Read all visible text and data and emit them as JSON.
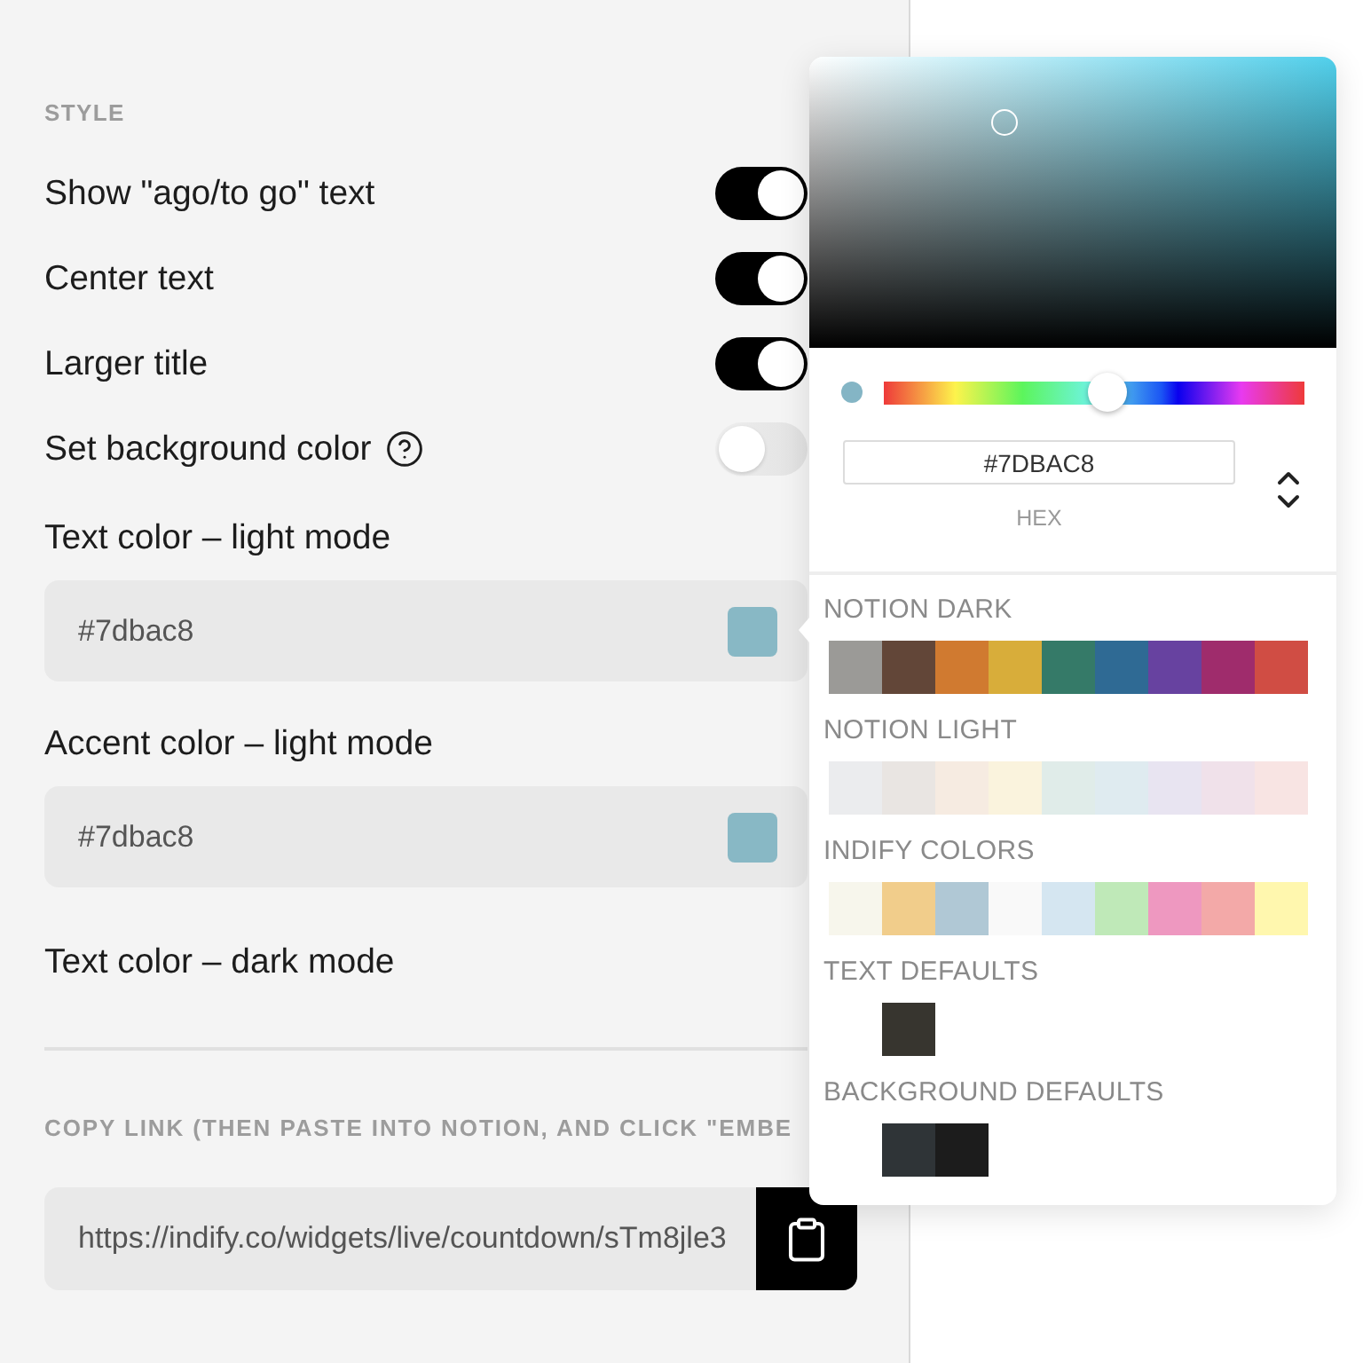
{
  "settings": {
    "heading": "STYLE",
    "toggles": [
      {
        "label": "Show \"ago/to go\" text",
        "on": true
      },
      {
        "label": "Center text",
        "on": true
      },
      {
        "label": "Larger title",
        "on": true
      },
      {
        "label": "Set background color",
        "on": false,
        "help": true
      }
    ]
  },
  "color_fields": [
    {
      "label": "Text color – light mode",
      "value": "#7dbac8",
      "color": "#88b8c5"
    },
    {
      "label": "Accent color – light mode",
      "value": "#7dbac8",
      "color": "#88b8c5"
    },
    {
      "label": "Text color – dark mode"
    }
  ],
  "copy_link": {
    "heading": "COPY LINK (THEN PASTE INTO NOTION, AND CLICK \"EMBE",
    "url": "https://indify.co/widgets/live/countdown/sTm8jle3"
  },
  "color_picker": {
    "saturation": {
      "level": 0.37
    },
    "color": "#84b5c5",
    "hue": {
      "level": 0.53
    },
    "hex": "#7DBAC8",
    "format": "HEX",
    "palettes": [
      {
        "title": "NOTION DARK",
        "kind": "palette",
        "swatches": [
          {
            "color": "#9b9a97"
          },
          {
            "color": "#624638"
          },
          {
            "color": "#d07a30"
          },
          {
            "color": "#d8ad3a"
          },
          {
            "color": "#357a68"
          },
          {
            "color": "#2f6a94"
          },
          {
            "color": "#6742a0"
          },
          {
            "color": "#9f2c6c"
          },
          {
            "color": "#d04d44"
          }
        ]
      },
      {
        "title": "NOTION LIGHT",
        "kind": "palette",
        "swatches": [
          {
            "color": "#ebecee"
          },
          {
            "color": "#e9e5e2"
          },
          {
            "color": "#f6ebe1"
          },
          {
            "color": "#faf3dd"
          },
          {
            "color": "#e0ece9"
          },
          {
            "color": "#dfebf0"
          },
          {
            "color": "#e8e4f1"
          },
          {
            "color": "#f0e1ea"
          },
          {
            "color": "#f8e4e3"
          }
        ]
      },
      {
        "title": "INDIFY COLORS",
        "kind": "palette",
        "swatches": [
          {
            "color": "#f7f6ec"
          },
          {
            "color": "#f1cd8b"
          },
          {
            "color": "#b0c8d5"
          },
          {
            "color": "#f9f9f9"
          },
          {
            "color": "#d5e6f1"
          },
          {
            "color": "#bfe9b8"
          },
          {
            "color": "#ee98c0"
          },
          {
            "color": "#f3a9a8"
          },
          {
            "color": "#fff7ae"
          }
        ]
      },
      {
        "title": "TEXT DEFAULTS",
        "kind": "defaults",
        "swatches": [
          {
            "color": "#37352f"
          }
        ]
      },
      {
        "title": "BACKGROUND DEFAULTS",
        "kind": "defaults",
        "swatches": [
          {
            "color": "#2f3437"
          },
          {
            "color": "#1c1c1c"
          }
        ]
      }
    ]
  }
}
